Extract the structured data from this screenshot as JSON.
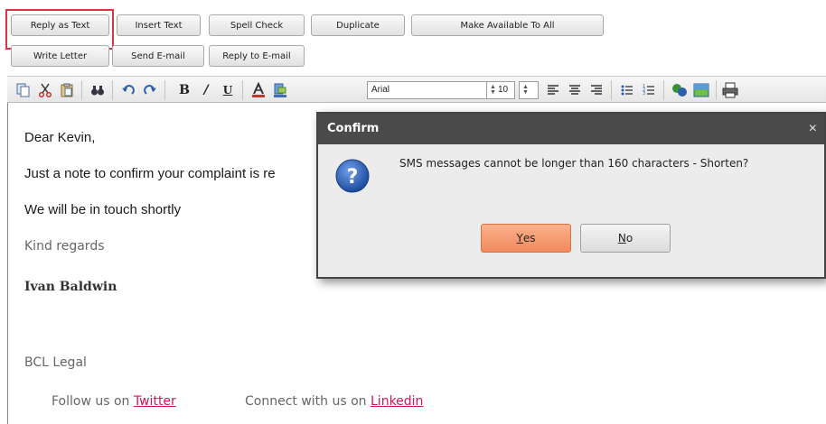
{
  "buttons": {
    "reply_as_text": "Reply as Text",
    "insert_text": "Insert Text",
    "spell_check": "Spell Check",
    "duplicate": "Duplicate",
    "make_available": "Make Available To All",
    "write_letter": "Write Letter",
    "send_email": "Send E-mail",
    "reply_to_email": "Reply to E-mail"
  },
  "toolbar": {
    "font": "Arial",
    "font_size": "10"
  },
  "editor": {
    "greeting": "Dear Kevin,",
    "line1": "Just a note to confirm your complaint is re",
    "line2": "We will be in touch shortly",
    "regards": "Kind regards",
    "name": "Ivan Baldwin",
    "company": "BCL Legal",
    "follow_text": "Follow us on",
    "twitter": "Twitter",
    "connect_text": "Connect with us on",
    "linkedin": "Linkedin"
  },
  "dialog": {
    "title": "Confirm",
    "close": "×",
    "message": "SMS messages cannot be longer than 160 characters - Shorten?",
    "yes_first": "Y",
    "yes_rest": "es",
    "no_first": "N",
    "no_rest": "o"
  },
  "colors": {
    "highlight": "#d9363e",
    "link": "#d4145a",
    "yes_button": "#f08a5d",
    "dialog_title": "#4a4a4a"
  }
}
